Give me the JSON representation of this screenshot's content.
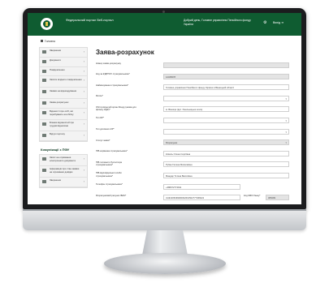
{
  "header": {
    "portal_title": "Федеральний портал Веб-портал",
    "greeting": "Добрий день, Головне управління Пенсійного фонду України",
    "exit_label": "Вихід"
  },
  "breadcrumb": {
    "home_label": "Головна"
  },
  "sidebar": {
    "items": [
      {
        "label": "Звернення"
      },
      {
        "label": "Документи"
      },
      {
        "label": "Повідомлення"
      },
      {
        "label": "Запити вхідного повідомлення"
      },
      {
        "label": "Заявки на відшкодування"
      },
      {
        "label": "Заява-розрахунок"
      },
      {
        "label": "Відомості про осіб, які перебувають на обліку"
      },
      {
        "label": "Бланки відомостей про трудові відносини"
      },
      {
        "label": "Відгук порталу"
      }
    ],
    "compliance_heading": "Комунікації з ПФУ",
    "compliance_items": [
      {
        "label": "Запит на отримання електронного документа"
      },
      {
        "label": "Інформація про стан заявки на отримання довідки"
      },
      {
        "label": "Звернення"
      }
    ]
  },
  "form": {
    "title": "Заява-розрахунок",
    "rows": [
      {
        "label": "Номер заяви-розрахунку",
        "value": "",
        "style": "gray"
      },
      {
        "label": "Код за ЄДРПОУ страхувальника*",
        "value": "12345678",
        "style": "gray"
      },
      {
        "label": "Найменування страхувальника*",
        "value": "Головне управління Пенсійного фонду України в Вінницькій області",
        "style": "plain"
      },
      {
        "label": "Регіон*",
        "value": "",
        "style": "select"
      },
      {
        "label": "Обслуговуючий орган Фонду (назва для філіалу ЄДР)*",
        "value": "м. Вінниця (вул. Хмельницьке шосе)",
        "style": "plain"
      },
      {
        "label": "Тип ЄР*",
        "value": "",
        "style": "select"
      },
      {
        "label": "Тип допомоги ЄР*",
        "value": "",
        "style": "select"
      },
      {
        "label": "Статус заяви*",
        "value": "Розрахунок",
        "style": "select gray"
      },
      {
        "label": "ПІБ керівника страхувальника*",
        "value": "Коваль Олена Сергіївна",
        "style": "plain"
      },
      {
        "label": "ПІБ головного бухгалтера страхувальника*",
        "value": "Рубан Галина Миколаївна",
        "style": "plain"
      },
      {
        "label": "ПІБ відповідальної особи страхувальника*",
        "value": "Мандар Тетяна Василівна",
        "style": "plain"
      },
      {
        "label": "Телефон страхувальника*",
        "value": "+380672774911",
        "style": "plain short"
      },
      {
        "label": "Розрахунковий рахунок IBAN*",
        "value": "UA91305299000002601502777366022",
        "style": "plain short",
        "extra_label": "Код МФО банку*",
        "extra_value": "305299"
      }
    ]
  }
}
